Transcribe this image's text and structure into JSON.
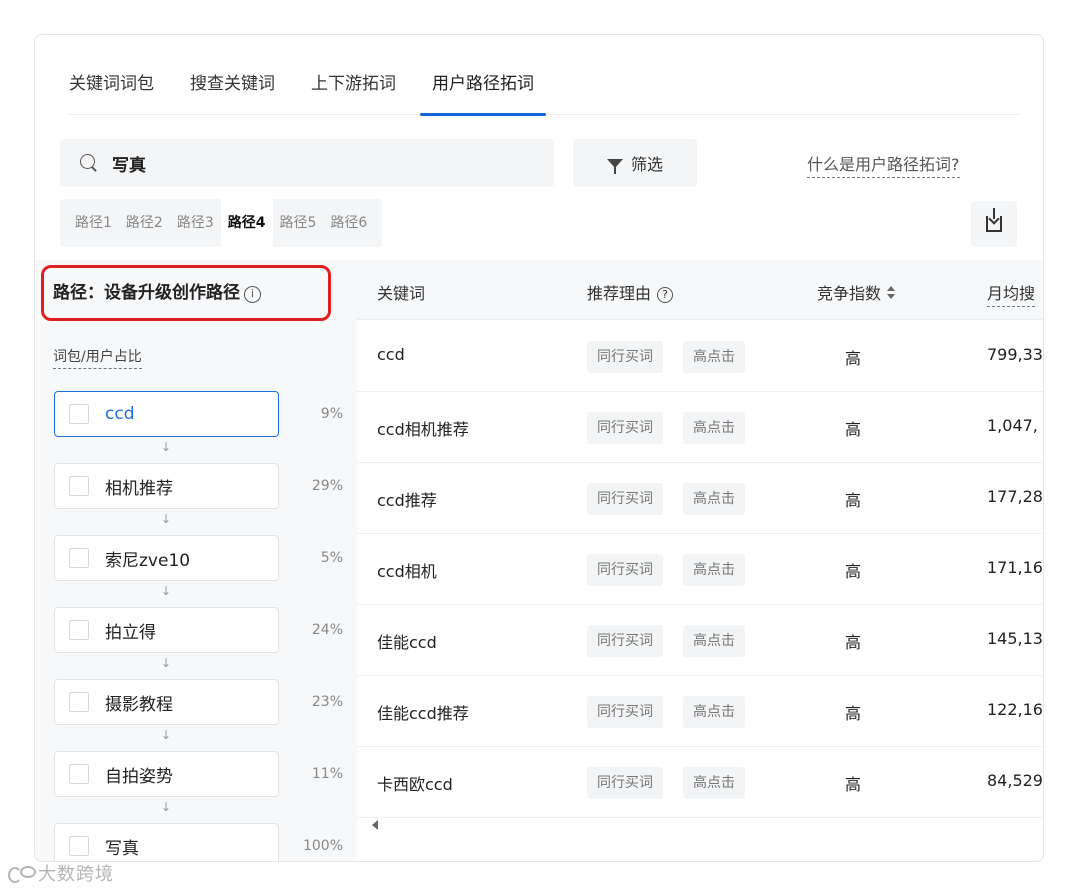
{
  "tabs": [
    {
      "label": "关键词词包"
    },
    {
      "label": "搜查关键词"
    },
    {
      "label": "上下游拓词"
    },
    {
      "label": "用户路径拓词"
    }
  ],
  "active_tab": "用户路径拓词",
  "search": {
    "value": "写真"
  },
  "filter": {
    "label": "筛选"
  },
  "help_link": "什么是用户路径拓词?",
  "paths": [
    {
      "label": "路径1"
    },
    {
      "label": "路径2"
    },
    {
      "label": "路径3"
    },
    {
      "label": "路径4"
    },
    {
      "label": "路径5"
    },
    {
      "label": "路径6"
    }
  ],
  "active_path": "路径4",
  "left": {
    "title": "路径：设备升级创作路径",
    "info_glyph": "i",
    "ratio_label": "词包/用户占比",
    "arrow_glyph": "↓",
    "steps": [
      {
        "label": "ccd",
        "pct": "9%",
        "selected": true
      },
      {
        "label": "相机推荐",
        "pct": "29%"
      },
      {
        "label": "索尼zve10",
        "pct": "5%"
      },
      {
        "label": "拍立得",
        "pct": "24%"
      },
      {
        "label": "摄影教程",
        "pct": "23%"
      },
      {
        "label": "自拍姿势",
        "pct": "11%"
      },
      {
        "label": "写真",
        "pct": "100%"
      }
    ]
  },
  "table": {
    "headers": {
      "keyword": "关键词",
      "reason": "推荐理由",
      "reason_help": "?",
      "competition": "竞争指数",
      "monthly": "月均搜"
    },
    "rows": [
      {
        "keyword": "ccd",
        "tags": [
          "同行买词",
          "高点击"
        ],
        "competition": "高",
        "monthly": "799,33"
      },
      {
        "keyword": "ccd相机推荐",
        "tags": [
          "同行买词",
          "高点击"
        ],
        "competition": "高",
        "monthly": "1,047,"
      },
      {
        "keyword": "ccd推荐",
        "tags": [
          "同行买词",
          "高点击"
        ],
        "competition": "高",
        "monthly": "177,28"
      },
      {
        "keyword": "ccd相机",
        "tags": [
          "同行买词",
          "高点击"
        ],
        "competition": "高",
        "monthly": "171,16"
      },
      {
        "keyword": "佳能ccd",
        "tags": [
          "同行买词",
          "高点击"
        ],
        "competition": "高",
        "monthly": "145,13"
      },
      {
        "keyword": "佳能ccd推荐",
        "tags": [
          "同行买词",
          "高点击"
        ],
        "competition": "高",
        "monthly": "122,16"
      },
      {
        "keyword": "卡西欧ccd",
        "tags": [
          "同行买词",
          "高点击"
        ],
        "competition": "高",
        "monthly": "84,529"
      }
    ]
  },
  "watermark": "大数跨境",
  "colors": {
    "accent": "#1565d8",
    "highlight_box": "#e0201f"
  }
}
